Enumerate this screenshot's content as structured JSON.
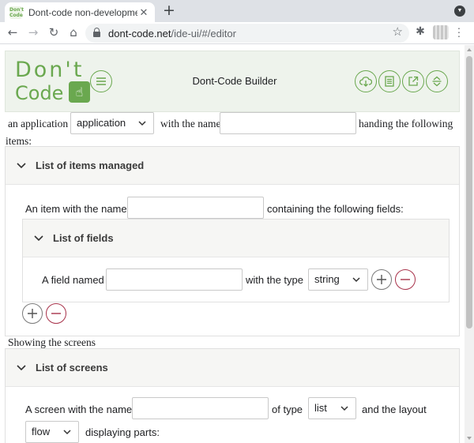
{
  "browser": {
    "tab_title": "Dont-code non-development",
    "favicon_text": "Don't Code",
    "url_host": "dont-code.net",
    "url_path": "/ide-ui/#/editor",
    "icons": [
      "back-arrow-icon",
      "forward-arrow-icon",
      "reload-icon",
      "home-icon",
      "lock-icon",
      "star-icon",
      "extension-icon",
      "menu-icon"
    ]
  },
  "header": {
    "logo_line1": "Don't",
    "logo_line2": "Code",
    "title": "Dont-Code Builder",
    "accent": "#6aa84f"
  },
  "app_line": {
    "prefix": "an application",
    "select_value": "application",
    "middle": "with the name",
    "suffix": "handing the following",
    "wrap": "items:"
  },
  "items_panel": {
    "title": "List of items managed",
    "row_prefix": "An item with the name",
    "row_suffix": "containing the following fields:"
  },
  "fields_panel": {
    "title": "List of fields",
    "row_prefix": "A field named",
    "row_middle": "with the type",
    "type_value": "string"
  },
  "screens_intro": "Showing the screens",
  "screens_panel": {
    "title": "List of screens",
    "row_prefix": "A screen with the name",
    "row_middle": "of type",
    "type_value": "list",
    "row_suffix": "and the layout",
    "layout_value": "flow",
    "parts_label": "displaying parts:"
  },
  "colors": {
    "add": "#7a7a7a",
    "remove": "#a8324a"
  }
}
